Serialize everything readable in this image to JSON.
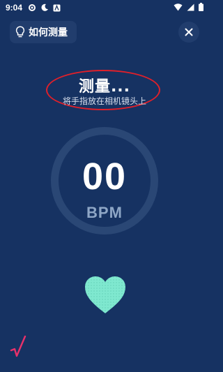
{
  "status_bar": {
    "time": "9:04",
    "icons": [
      "settings-icon",
      "moon-icon",
      "a-badge-icon",
      "wifi-icon",
      "signal-icon",
      "battery-icon"
    ]
  },
  "header": {
    "howto_label": "如何测量",
    "howto_icon": "lightbulb-icon",
    "close_icon": "close-icon"
  },
  "measurement": {
    "title": "测量...",
    "instruction": "将手指放在相机镜头上",
    "value": "00",
    "unit": "BPM"
  },
  "colors": {
    "background": "#163262",
    "button_bg": "#213d6d",
    "ring": "#2a4775",
    "heart": "#7fe8cf",
    "annotation": "#e0202a",
    "unit_text": "#8ea6c6"
  }
}
